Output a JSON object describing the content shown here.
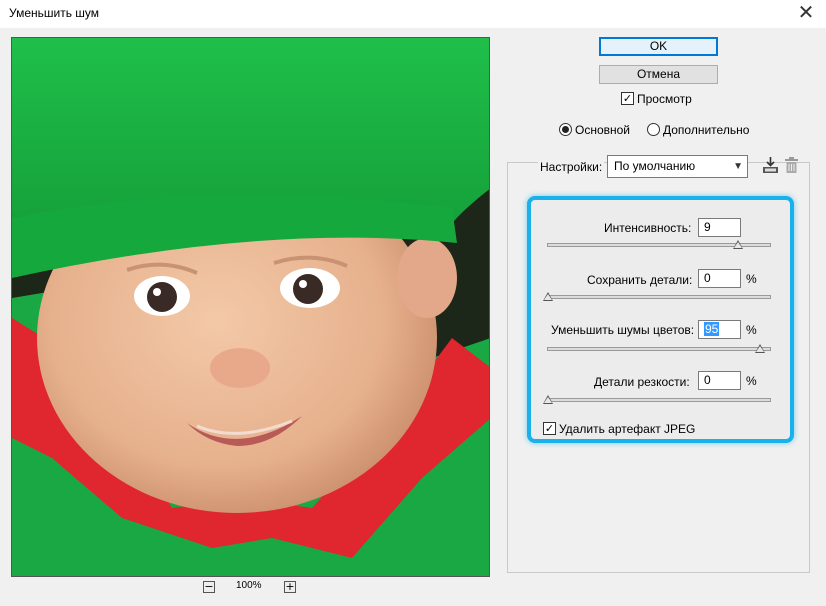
{
  "window": {
    "title": "Уменьшить шум",
    "close_glyph": "✕"
  },
  "buttons": {
    "ok": "OK",
    "cancel": "Отмена"
  },
  "preview_toggle": {
    "label": "Просмотр",
    "checked": true
  },
  "mode": {
    "basic": "Основной",
    "advanced": "Дополнительно",
    "selected": "basic"
  },
  "settings": {
    "label": "Настройки:",
    "value": "По умолчанию",
    "save_icon": "save-icon",
    "delete_icon": "trash-icon"
  },
  "params": {
    "strength": {
      "label": "Интенсивность:",
      "value": "9",
      "slider_fraction": 0.9
    },
    "preserve_details": {
      "label": "Сохранить детали:",
      "value": "0",
      "unit": "%",
      "slider_fraction": 0.0
    },
    "reduce_color_noise": {
      "label": "Уменьшить шумы цветов:",
      "value": "95",
      "unit": "%",
      "slider_fraction": 0.95
    },
    "sharpen_details": {
      "label": "Детали резкости:",
      "value": "0",
      "unit": "%",
      "slider_fraction": 0.0
    }
  },
  "jpeg_artifact": {
    "label": "Удалить артефакт JPEG",
    "checked": true
  },
  "zoom": {
    "minus": "−",
    "plus": "+",
    "value": "100%"
  },
  "colors": {
    "accent_highlight": "#1ab0ea",
    "ok_border": "#0078d7"
  }
}
